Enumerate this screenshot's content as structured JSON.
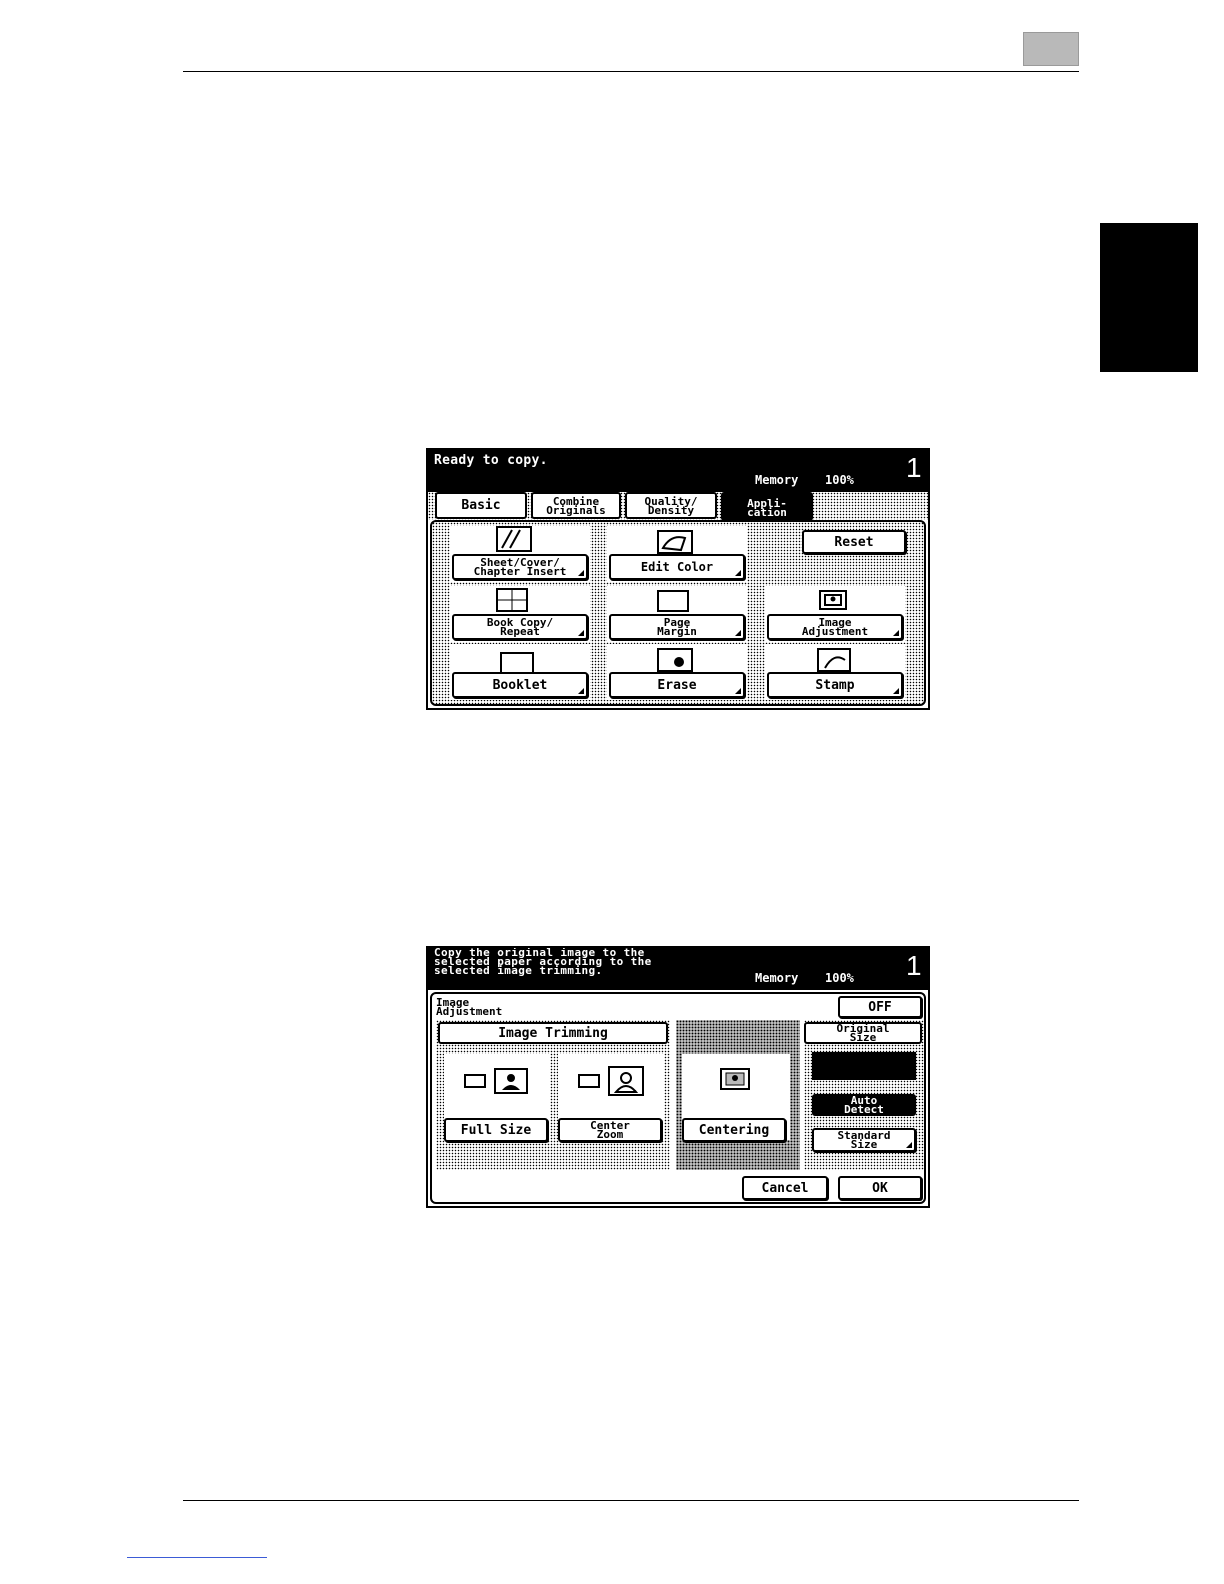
{
  "screen1": {
    "message": "Ready to copy.",
    "memory_label": "Memory",
    "memory_value": "100%",
    "set_count": "1",
    "tabs": [
      {
        "lines": [
          "Basic"
        ]
      },
      {
        "lines": [
          "Combine",
          "Originals"
        ]
      },
      {
        "lines": [
          "Quality/",
          "Density"
        ]
      },
      {
        "lines": [
          "Appli-",
          "cation"
        ]
      }
    ],
    "functions": {
      "sheet_cover": [
        "Sheet/Cover/",
        "Chapter Insert"
      ],
      "edit_color": "Edit Color",
      "reset": "Reset",
      "book_copy": [
        "Book Copy/",
        "Repeat"
      ],
      "page_margin": [
        "Page",
        "Margin"
      ],
      "image_adjustment": [
        "Image",
        "Adjustment"
      ],
      "booklet": "Booklet",
      "erase": "Erase",
      "stamp": "Stamp"
    }
  },
  "screen2": {
    "message_lines": [
      "Copy the original image to the",
      "selected paper according to the",
      "selected image trimming."
    ],
    "memory_label": "Memory",
    "memory_value": "100%",
    "set_count": "1",
    "title_lines": [
      "Image",
      "Adjustment"
    ],
    "off_button": "OFF",
    "image_trimming_header": "Image Trimming",
    "full_size": "Full Size",
    "center_zoom": [
      "Center",
      "Zoom"
    ],
    "centering": "Centering",
    "original_size_header": [
      "Original",
      "Size"
    ],
    "auto_detect": [
      "Auto",
      "Detect"
    ],
    "standard_size": [
      "Standard",
      "Size"
    ],
    "cancel": "Cancel",
    "ok": "OK"
  }
}
